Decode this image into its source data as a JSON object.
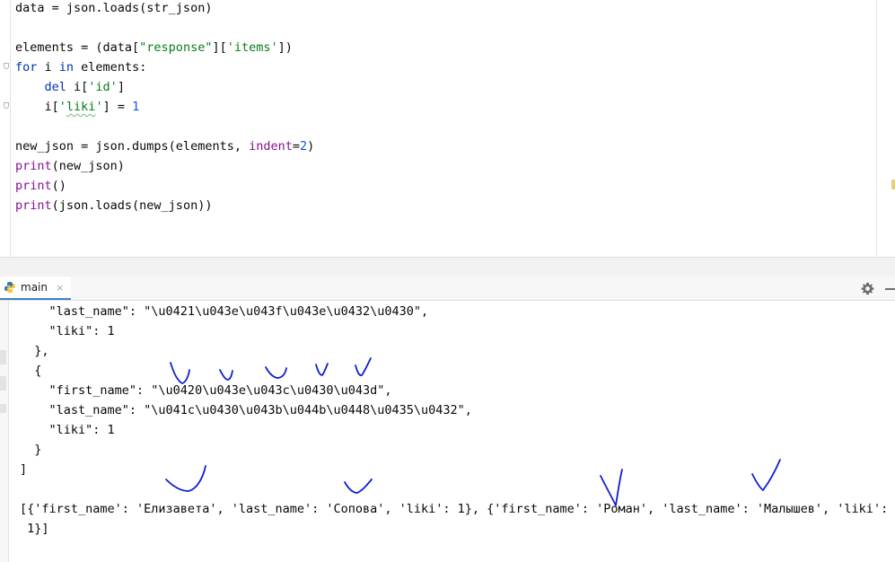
{
  "editor": {
    "lines": {
      "l1": {
        "a": "data = json.loads(str_json)"
      },
      "l2": {
        "a": "elements = (data[",
        "s1": "\"response\"",
        "b": "][",
        "s2": "'items'",
        "c": "])"
      },
      "l3": {
        "kw1": "for",
        "a": " i ",
        "kw2": "in",
        "b": " elements:"
      },
      "l4": {
        "indent": "    ",
        "kw": "del",
        "a": " i[",
        "s": "'id'",
        "b": "]"
      },
      "l5": {
        "indent": "    ",
        "a": "i[",
        "s1": "'",
        "typo": "liki",
        "s2": "'",
        "b": "] = ",
        "n": "1"
      },
      "l6": {
        "a": "new_json = json.dumps(elements, ",
        "p": "indent",
        "b": "=",
        "n": "2",
        "c": ")"
      },
      "l7": {
        "f": "print",
        "a": "(new_json)"
      },
      "l8": {
        "f": "print",
        "a": "()"
      },
      "l9": {
        "f": "print",
        "a": "(json.loads(new_json))"
      }
    }
  },
  "run_panel": {
    "tab_label": "main",
    "tab_close": "×",
    "icons": {
      "tab": "python-icon",
      "settings": "gear-icon",
      "hide": "minimize-icon"
    }
  },
  "console": {
    "lines": [
      "    \"last_name\": \"\\u0421\\u043e\\u043f\\u043e\\u0432\\u0430\",",
      "    \"liki\": 1",
      "  },",
      "  {",
      "    \"first_name\": \"\\u0420\\u043e\\u043c\\u0430\\u043d\",",
      "    \"last_name\": \"\\u041c\\u0430\\u043b\\u044b\\u0448\\u0435\\u0432\",",
      "    \"liki\": 1",
      "  }",
      "]",
      "",
      "[{'first_name': 'Елизавета', 'last_name': 'Сопова', 'liki': 1}, {'first_name': 'Роман', 'last_name': 'Малышев', 'liki':",
      " 1}]"
    ]
  },
  "colors": {
    "keyword": "#0033b3",
    "string": "#067d17",
    "number": "#1750eb",
    "builtin": "#871094",
    "handwriting": "#1020d0",
    "tab_underline": "#4083c9"
  }
}
